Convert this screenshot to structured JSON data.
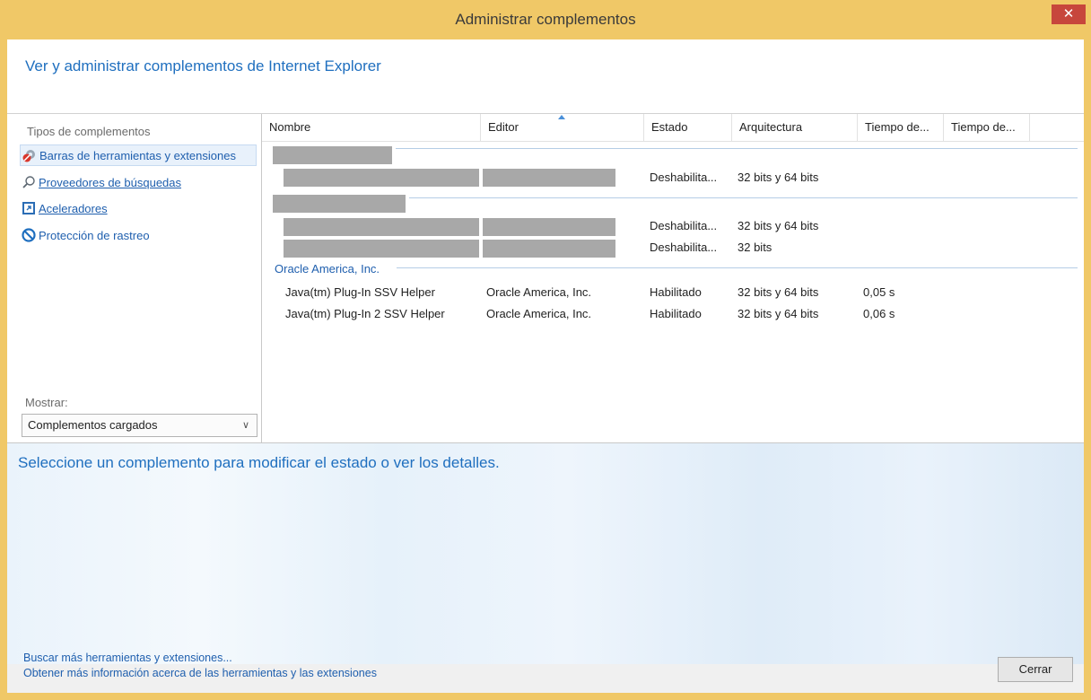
{
  "window": {
    "title": "Administrar complementos",
    "close_glyph": "✕"
  },
  "header": {
    "text": "Ver y administrar complementos de Internet Explorer"
  },
  "left_panel": {
    "title": "Tipos de complementos",
    "items": [
      {
        "label": "Barras de herramientas y extensiones",
        "icon": "gear-block-icon",
        "selected": true
      },
      {
        "label": "Proveedores de búsquedas",
        "icon": "search-icon",
        "selected": false
      },
      {
        "label": "Aceleradores",
        "icon": "accelerator-icon",
        "selected": false
      },
      {
        "label": "Protección de rastreo",
        "icon": "tracking-protection-icon",
        "selected": false
      }
    ],
    "show_label": "Mostrar:",
    "show_value": "Complementos cargados"
  },
  "table": {
    "columns": [
      "Nombre",
      "Editor",
      "Estado",
      "Arquitectura",
      "Tiempo de...",
      "Tiempo de..."
    ],
    "redacted_rows": [
      {
        "status": "Deshabilita...",
        "arch": "32 bits y 64 bits"
      },
      {
        "status": "Deshabilita...",
        "arch": "32 bits y 64 bits"
      },
      {
        "status": "Deshabilita...",
        "arch": "32 bits"
      }
    ],
    "group": "Oracle America, Inc.",
    "rows": [
      {
        "name": "Java(tm) Plug-In SSV Helper",
        "publisher": "Oracle America, Inc.",
        "status": "Habilitado",
        "arch": "32 bits y 64 bits",
        "load_time": "0,05 s"
      },
      {
        "name": "Java(tm) Plug-In 2 SSV Helper",
        "publisher": "Oracle America, Inc.",
        "status": "Habilitado",
        "arch": "32 bits y 64 bits",
        "load_time": "0,06 s"
      }
    ]
  },
  "details": {
    "text": "Seleccione un complemento para modificar el estado o ver los detalles."
  },
  "footer": {
    "link1": "Buscar más herramientas y extensiones...",
    "link2": "Obtener más información acerca de las herramientas y las extensiones",
    "close_label": "Cerrar"
  },
  "colors": {
    "titlebar": "#f0c867",
    "accent": "#1f6fbf",
    "close": "#c7463c"
  }
}
